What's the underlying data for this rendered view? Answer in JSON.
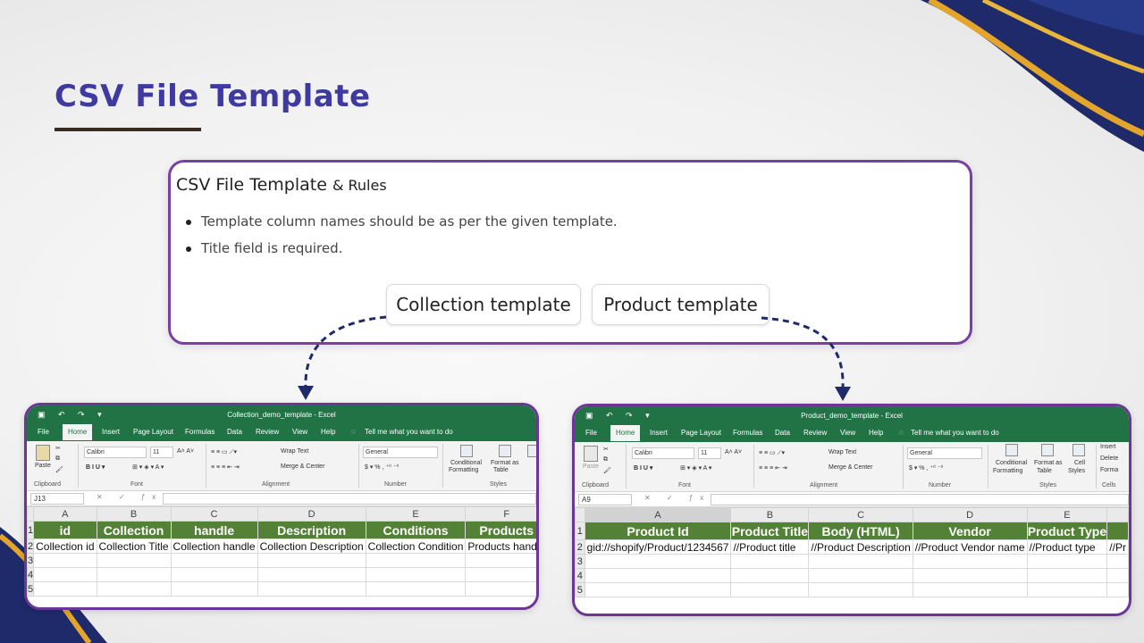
{
  "slide": {
    "title": "CSV File Template"
  },
  "rules_card": {
    "heading_main": "CSV File Template",
    "heading_suffix": "& Rules",
    "rules": [
      "Template column names should be as per the given template.",
      "Title field is required."
    ],
    "buttons": {
      "collection": "Collection template",
      "product": "Product template"
    }
  },
  "excel_common": {
    "tabs": [
      "File",
      "Home",
      "Insert",
      "Page Layout",
      "Formulas",
      "Data",
      "Review",
      "View",
      "Help"
    ],
    "tell_me": "Tell me what you want to do",
    "ribbon": {
      "paste": "Paste",
      "clipboard": "Clipboard",
      "font_name": "Calibri",
      "font_size": "11",
      "font_group": "Font",
      "wrap_text": "Wrap Text",
      "merge_center": "Merge & Center",
      "alignment": "Alignment",
      "number_format": "General",
      "number": "Number",
      "conditional": "Conditional",
      "formatting": "Formatting",
      "format_as": "Format as",
      "table": "Table",
      "cell": "Cell",
      "styles_btn": "Styles",
      "styles": "Styles",
      "cells": "Cells",
      "insert": "Insert",
      "delete": "Delete",
      "format": "Forma"
    }
  },
  "excel_left": {
    "filename": "Collection_demo_template  -  Excel",
    "name_box": "J13",
    "columns": [
      "A",
      "B",
      "C",
      "D",
      "E",
      "F"
    ],
    "headers": [
      "id",
      "Collection",
      "handle",
      "Description",
      "Conditions",
      "Products"
    ],
    "row2": [
      "Collection id",
      "Collection Title",
      "Collection handle",
      "Collection Description",
      "Collection Condition",
      "Products handle"
    ],
    "rows": [
      "1",
      "2",
      "3",
      "4",
      "5"
    ]
  },
  "excel_right": {
    "filename": "Product_demo_template  -  Excel",
    "name_box": "A9",
    "columns": [
      "A",
      "B",
      "C",
      "D",
      "E"
    ],
    "headers": [
      "Product Id",
      "Product Title",
      "Body (HTML)",
      "Vendor",
      "Product Type"
    ],
    "row2": [
      "gid://shopify/Product/1234567",
      "//Product title",
      "//Product Description",
      "//Product Vendor name",
      "//Product type",
      "//Pr"
    ],
    "rows": [
      "1",
      "2",
      "3",
      "4",
      "5"
    ]
  }
}
